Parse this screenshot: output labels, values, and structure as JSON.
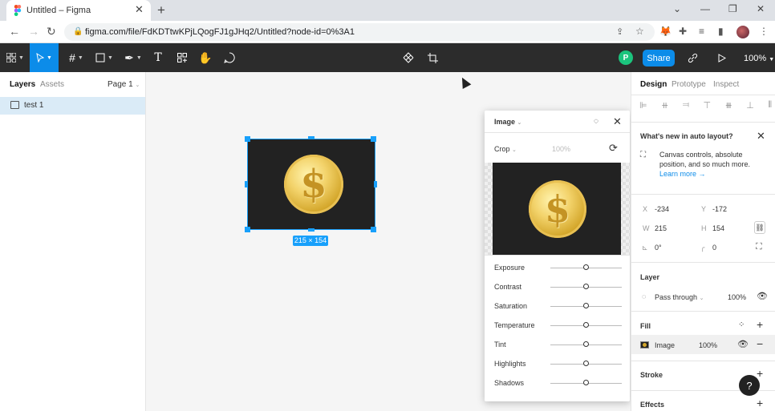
{
  "browser": {
    "tab_title": "Untitled – Figma",
    "tab_close": "✕",
    "new_tab": "+",
    "window_controls": [
      "⌄",
      "—",
      "❐",
      "✕"
    ],
    "url": "figma.com/file/FdKDTtwKPjLQogFJ1gJHq2/Untitled?node-id=0%3A1",
    "nav": [
      "←",
      "→",
      "↻"
    ],
    "extensions": [
      "share-icon",
      "star-icon",
      "fox-icon",
      "puzzle-icon",
      "media-icon",
      "sidepanel-icon",
      "profile-avatar",
      "menu-icon"
    ]
  },
  "toolbar": {
    "tools": [
      "main-menu-icon",
      "move-tool-icon",
      "frame-tool-icon",
      "shape-tool-icon",
      "pen-tool-icon",
      "text-tool-icon",
      "resources-icon",
      "hand-tool-icon",
      "comment-icon"
    ],
    "center_tools": [
      "component-icon",
      "crop-icon"
    ],
    "user_initial": "P",
    "share_label": "Share",
    "zoom": "100%"
  },
  "left_panel": {
    "tabs": [
      "Layers",
      "Assets"
    ],
    "page": "Page 1",
    "layers": [
      {
        "name": "test 1",
        "icon": "image-icon"
      }
    ]
  },
  "canvas": {
    "frame_size_label": "215 × 154",
    "coin_glyph": "$"
  },
  "image_popup": {
    "title": "Image",
    "mode": "Crop",
    "percent": "100%",
    "adjustments": [
      {
        "label": "Exposure",
        "value": 0
      },
      {
        "label": "Contrast",
        "value": 0
      },
      {
        "label": "Saturation",
        "value": 0
      },
      {
        "label": "Temperature",
        "value": 0
      },
      {
        "label": "Tint",
        "value": 0
      },
      {
        "label": "Highlights",
        "value": 0
      },
      {
        "label": "Shadows",
        "value": 0
      }
    ]
  },
  "right_panel": {
    "tabs": [
      "Design",
      "Prototype",
      "Inspect"
    ],
    "whats_new_title": "What's new in auto layout?",
    "whats_new_body_1": "Canvas controls, absolute",
    "whats_new_body_2": "position, and so much more.",
    "learn_more": "Learn more →",
    "x_label": "X",
    "x_value": "-234",
    "y_label": "Y",
    "y_value": "-172",
    "w_label": "W",
    "w_value": "215",
    "h_label": "H",
    "h_value": "154",
    "rotation": "0°",
    "corner_radius": "0",
    "layer_heading": "Layer",
    "blend_mode": "Pass through",
    "layer_opacity": "100%",
    "fill_heading": "Fill",
    "fill_type": "Image",
    "fill_opacity": "100%",
    "stroke_heading": "Stroke",
    "effects_heading": "Effects",
    "help": "?"
  },
  "colors": {
    "accent": "#0c8ce9",
    "selection": "#18a0fb",
    "toolbar_bg": "#2c2c2c",
    "avatar": "#1bc47d"
  }
}
